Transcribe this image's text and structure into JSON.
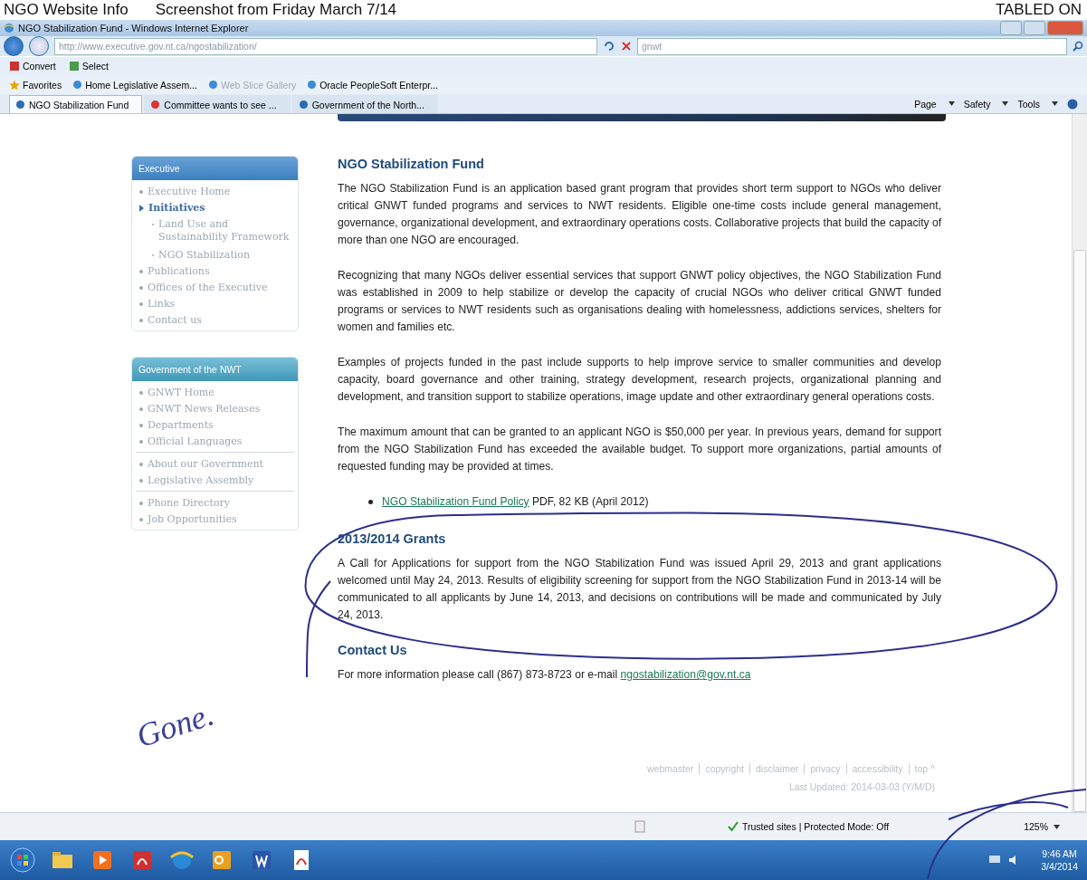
{
  "scan_header": {
    "title": "NGO Website Info",
    "subtitle": "Screenshot from Friday March 7/14",
    "stamp": "TABLED ON"
  },
  "window": {
    "title": "NGO Stabilization Fund - Windows Internet Explorer"
  },
  "address_bar": {
    "url": "http://www.executive.gov.nt.ca/ngostabilization/"
  },
  "search": {
    "value": "gnwt"
  },
  "command_bar": [
    {
      "label": "Convert"
    },
    {
      "label": "Select"
    }
  ],
  "favorites_bar": {
    "label": "Favorites",
    "items": [
      {
        "label": "Home  Legislative Assem...",
        "disabled": false
      },
      {
        "label": "Web Slice Gallery",
        "disabled": true
      },
      {
        "label": "Oracle  PeopleSoft Enterpr...",
        "disabled": false
      }
    ]
  },
  "tabs": [
    {
      "label": "NGO Stabilization Fund",
      "selected": true
    },
    {
      "label": "Committee wants to see ...",
      "selected": false
    },
    {
      "label": "Government of the North...",
      "selected": false
    }
  ],
  "tools_menu": [
    "Page",
    "Safety",
    "Tools"
  ],
  "sidebar": [
    {
      "title": "Executive",
      "groups": [
        {
          "items": [
            {
              "label": "Executive Home",
              "selected": false
            },
            {
              "label": "Initiatives",
              "selected": true,
              "children": [
                {
                  "label": "Land Use and Sustainability Framework",
                  "selected": false
                },
                {
                  "label": "NGO Stabilization",
                  "selected": false
                }
              ]
            },
            {
              "label": "Publications",
              "selected": false
            },
            {
              "label": "Offices of the Executive",
              "selected": false
            },
            {
              "label": "Links",
              "selected": false
            },
            {
              "label": "Contact us",
              "selected": false
            }
          ]
        }
      ]
    },
    {
      "title": "Government of the NWT",
      "groups": [
        {
          "items": [
            {
              "label": "GNWT Home",
              "selected": false
            },
            {
              "label": "GNWT News Releases",
              "selected": false
            },
            {
              "label": "Departments",
              "selected": false
            },
            {
              "label": "Official Languages",
              "selected": false
            }
          ]
        },
        {
          "items": [
            {
              "label": "About our Government",
              "selected": false
            },
            {
              "label": "Legislative Assembly",
              "selected": false
            }
          ]
        },
        {
          "items": [
            {
              "label": "Phone Directory",
              "selected": false
            },
            {
              "label": "Job Opportunities",
              "selected": false
            }
          ]
        }
      ]
    }
  ],
  "main": {
    "heading": "NGO Stabilization Fund",
    "paragraphs": [
      "The NGO Stabilization Fund is an application based grant program that provides short term support to NGOs who deliver critical GNWT funded programs and services to NWT residents. Eligible one-time costs include general management, governance, organizational development, and extraordinary operations costs. Collaborative projects that build the capacity of more than one NGO are encouraged.",
      "Recognizing that many NGOs deliver essential services that support GNWT policy objectives, the NGO Stabilization Fund was established in 2009 to help stabilize or develop the capacity of crucial NGOs who deliver critical GNWT funded programs or services to NWT residents such as organisations dealing with homelessness, addictions services, shelters for women and families etc.",
      "Examples of projects funded in the past include supports to help improve service to smaller communities and develop capacity, board governance and other training, strategy development, research projects, organizational planning and development, and transition support to stabilize operations, image update and other extraordinary general operations costs.",
      "The maximum amount that can be granted to an applicant NGO is $50,000 per year. In previous years, demand for support from the NGO Stabilization Fund has exceeded the available budget. To support more organizations, partial amounts of requested funding may be provided at times."
    ],
    "documents": [
      {
        "link": "NGO Stabilization Fund Policy",
        "details": "PDF, 82 KB (April 2012)"
      }
    ],
    "grants": {
      "heading": "2013/2014 Grants",
      "text": "A Call for Applications for support from the NGO Stabilization Fund was issued April 29, 2013 and grant applications welcomed until May 24, 2013. Results of eligibility screening for support from the NGO Stabilization Fund in 2013-14 will be communicated to all applicants by June 14, 2013, and decisions on contributions will be made and communicated by July 24, 2013."
    },
    "contact": {
      "heading": "Contact Us",
      "text": "For more information please call (867) 873-8723 or e-mail",
      "email": "ngostabilization@gov.nt.ca"
    }
  },
  "footer": {
    "links": [
      "webmaster",
      "copyright",
      "disclaimer",
      "privacy",
      "accessibility",
      "top ^"
    ],
    "last_updated": "Last Updated: 2014-03-03 (Y/M/D)"
  },
  "status_bar": {
    "zone": "Trusted sites | Protected Mode: Off",
    "zoom": "125%"
  },
  "taskbar": {
    "time": "9:46 AM",
    "date": "3/4/2014"
  },
  "annotation": {
    "note": "Gone."
  }
}
